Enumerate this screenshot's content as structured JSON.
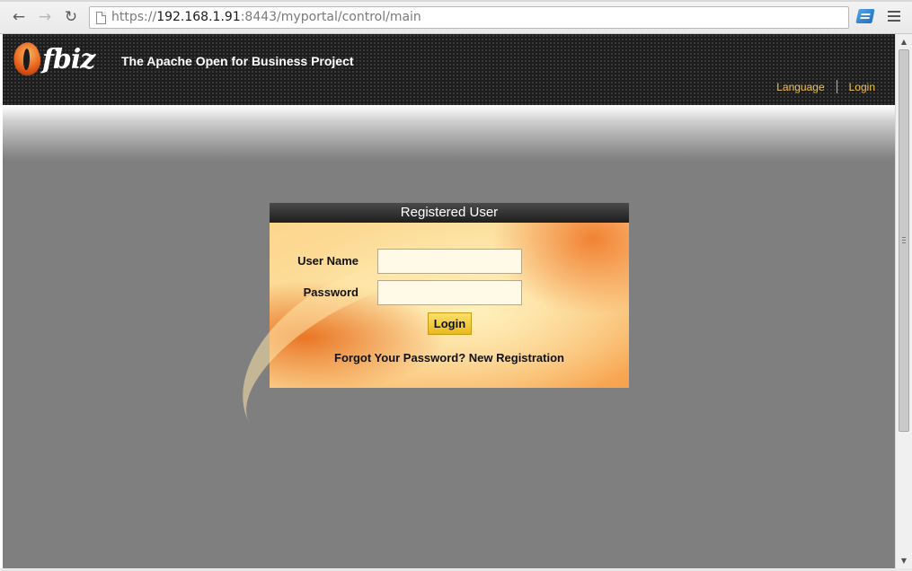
{
  "browser": {
    "url_prefix": "https://",
    "url_host": "192.168.1.91",
    "url_rest": ":8443/myportal/control/main",
    "back_icon": "←",
    "forward_icon": "→",
    "reload_icon": "↻"
  },
  "header": {
    "logo_text": "fbiz",
    "site_title": "The Apache Open for Business Project",
    "nav": {
      "language": "Language",
      "login": "Login"
    }
  },
  "login_box": {
    "title": "Registered User",
    "username_label": "User Name",
    "username_value": "",
    "password_label": "Password",
    "password_value": "",
    "submit_label": "Login",
    "forgot_link": "Forgot Your Password?",
    "register_link": "New Registration"
  },
  "scrollbar": {
    "up_arrow": "▲",
    "down_arrow": "▼"
  },
  "colors": {
    "header_bg": "#1c1c1c",
    "nav_link": "#f2c14e",
    "page_bg": "#7f7f7f",
    "login_head_bg": "#2a2a2a",
    "button_bg": "#f2cd3a"
  }
}
